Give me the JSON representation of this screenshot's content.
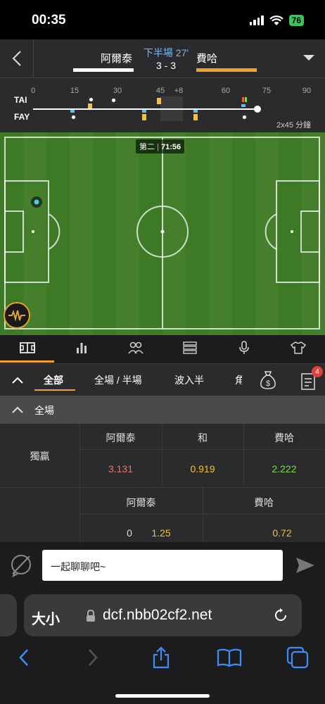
{
  "status_bar": {
    "time": "00:35",
    "battery": "76"
  },
  "match": {
    "home_team": "阿爾泰",
    "away_team": "費哈",
    "period": "下半場 27'",
    "score": "3 - 3",
    "home_color": "#ffffff",
    "away_color": "#f3a12f"
  },
  "timeline": {
    "home_label": "TAI",
    "away_label": "FAY",
    "ticks": [
      "0",
      "15",
      "30",
      "45",
      "+8",
      "60",
      "75",
      "90"
    ],
    "duration_label": "2x45 分鐘"
  },
  "pitch": {
    "timer_prefix": "第二",
    "timer": "71:56"
  },
  "tabs": [
    "pitch-icon",
    "stats-icon",
    "lineup-icon",
    "list-icon",
    "mic-icon",
    "shirt-icon"
  ],
  "filters": {
    "items": [
      "全部",
      "全場 / 半場",
      "波入半",
      "角"
    ],
    "active": "全部",
    "badge_count": "4"
  },
  "section": {
    "title": "全場"
  },
  "odds": {
    "market1": {
      "label": "獨贏",
      "headers": [
        "阿爾泰",
        "和",
        "費哈"
      ],
      "values": [
        "3.131",
        "0.919",
        "2.222"
      ],
      "colors": [
        "#e57373",
        "#f0c239",
        "#7fd858"
      ]
    },
    "market2": {
      "headers": [
        "阿爾泰",
        "費哈"
      ],
      "line": "0",
      "values": [
        "1.25",
        "0.72"
      ]
    }
  },
  "chat": {
    "placeholder": "一起聊聊吧~"
  },
  "browser": {
    "text_size": "大小",
    "url": "dcf.nbb02cf2.net"
  }
}
